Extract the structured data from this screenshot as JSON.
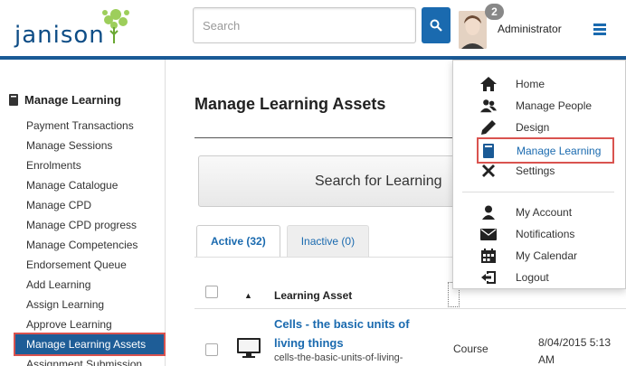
{
  "header": {
    "logo_text": "janison",
    "search_placeholder": "Search",
    "notification_count": "2",
    "username": "Administrator"
  },
  "sidebar": {
    "title": "Manage Learning",
    "items": [
      {
        "label": "Payment Transactions"
      },
      {
        "label": "Manage Sessions"
      },
      {
        "label": "Enrolments"
      },
      {
        "label": "Manage Catalogue"
      },
      {
        "label": "Manage CPD"
      },
      {
        "label": "Manage CPD progress"
      },
      {
        "label": "Manage Competencies"
      },
      {
        "label": "Endorsement Queue"
      },
      {
        "label": "Add Learning"
      },
      {
        "label": "Assign Learning"
      },
      {
        "label": "Approve Learning"
      },
      {
        "label": "Manage Learning Assets"
      },
      {
        "label": "Assignment Submission"
      }
    ],
    "active_index": 11
  },
  "main": {
    "title": "Manage Learning Assets",
    "search_button": "Search for Learning",
    "tabs": [
      {
        "label": "Active (32)"
      },
      {
        "label": "Inactive (0)"
      }
    ],
    "table": {
      "columns": {
        "asset": "Learning Asset"
      },
      "rows": [
        {
          "title": "Cells - the basic units of living things",
          "slug": "cells-the-basic-units-of-living-",
          "type": "Course",
          "date": "8/04/2015 5:13 AM"
        }
      ]
    }
  },
  "dropdown": {
    "group1": [
      {
        "label": "Home",
        "icon": "home-icon"
      },
      {
        "label": "Manage People",
        "icon": "people-icon"
      },
      {
        "label": "Design",
        "icon": "pencil-icon"
      },
      {
        "label": "Manage Learning",
        "icon": "book-icon"
      },
      {
        "label": "Settings",
        "icon": "tools-icon"
      }
    ],
    "group2": [
      {
        "label": "My Account",
        "icon": "user-icon"
      },
      {
        "label": "Notifications",
        "icon": "envelope-icon"
      },
      {
        "label": "My Calendar",
        "icon": "calendar-icon"
      },
      {
        "label": "Logout",
        "icon": "logout-icon"
      }
    ],
    "active_label": "Manage Learning"
  },
  "colors": {
    "brand_blue": "#1a5a96",
    "link_blue": "#1a6aaf",
    "highlight_red": "#d9534f"
  }
}
